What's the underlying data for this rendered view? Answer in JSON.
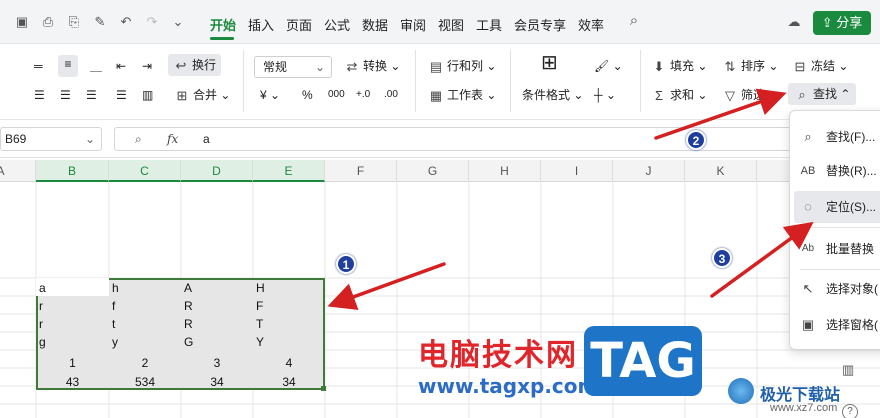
{
  "topbar": {
    "menus": [
      "开始",
      "插入",
      "页面",
      "公式",
      "数据",
      "审阅",
      "视图",
      "工具",
      "会员专享",
      "效率"
    ],
    "share": "分享"
  },
  "ribbon": {
    "wrap": "换行",
    "merge": "合并",
    "format_value": "常规",
    "convert": "转换",
    "rowcol": "行和列",
    "sheet": "工作表",
    "condfmt": "条件格式",
    "fill": "填充",
    "sort": "排序",
    "freeze": "冻结",
    "sum": "求和",
    "filter": "筛选",
    "find": "查找"
  },
  "formula_bar": {
    "namebox": "B69",
    "fx": "fx",
    "content": "a"
  },
  "columns": [
    "A",
    "B",
    "C",
    "D",
    "E",
    "F",
    "G",
    "H",
    "I",
    "J",
    "K"
  ],
  "table": {
    "text_rows": [
      [
        "a",
        "h",
        "A",
        "H"
      ],
      [
        "r",
        "f",
        "R",
        "F"
      ],
      [
        "r",
        "t",
        "R",
        "T"
      ],
      [
        "g",
        "y",
        "G",
        "Y"
      ]
    ],
    "num_rows": [
      [
        "1",
        "2",
        "3",
        "4"
      ],
      [
        "43",
        "534",
        "34",
        "34"
      ]
    ]
  },
  "dropdown": {
    "items": [
      {
        "label": "查找(F)...",
        "icon": "search-icon"
      },
      {
        "label": "替换(R)...",
        "icon": "replace-icon"
      },
      {
        "label": "定位(S)...",
        "icon": "locate-icon"
      },
      {
        "label": "批量替换",
        "icon": "batch-replace-icon"
      },
      {
        "label": "选择对象(",
        "icon": "cursor-icon"
      },
      {
        "label": "选择窗格(",
        "icon": "pane-icon"
      }
    ]
  },
  "badges": [
    "1",
    "2",
    "3"
  ],
  "watermarks": {
    "text": "电脑技术网",
    "url": "www.tagxp.com",
    "tag": "TAG",
    "corner": "极光下载站",
    "corner_url": "www.xz7.com"
  },
  "colors": {
    "accent": "#1a8a3e",
    "arrow": "#d42020",
    "badge": "#1f3f9e"
  }
}
